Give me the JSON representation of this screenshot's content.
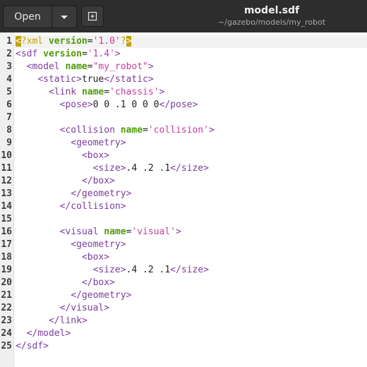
{
  "header": {
    "open_label": "Open",
    "menu_icon": "chevron-down-icon",
    "new_tab_icon": "new-tab-icon",
    "title": "model.sdf",
    "subtitle": "~/gazebo/models/my_robot"
  },
  "colors": {
    "tag": "#7a3e9d",
    "attribute": "#4e9a06",
    "string": "#c53f9c",
    "text": "#222222",
    "processing_instruction": "#c4a000"
  },
  "editor": {
    "cursor_line": 1,
    "lines": [
      {
        "n": "1",
        "tokens": [
          {
            "t": "pi-hl",
            "v": "<"
          },
          {
            "t": "pi",
            "v": "?xml "
          },
          {
            "t": "attr",
            "v": "version"
          },
          {
            "t": "txt",
            "v": "="
          },
          {
            "t": "str",
            "v": "'1.0'"
          },
          {
            "t": "pi",
            "v": "?"
          },
          {
            "t": "pi-hl",
            "v": ">"
          }
        ]
      },
      {
        "n": "2",
        "tokens": [
          {
            "t": "tag",
            "v": "<sdf "
          },
          {
            "t": "attr",
            "v": "version"
          },
          {
            "t": "txt",
            "v": "="
          },
          {
            "t": "str",
            "v": "'1.4'"
          },
          {
            "t": "tag",
            "v": ">"
          }
        ]
      },
      {
        "n": "3",
        "tokens": [
          {
            "t": "txt",
            "v": "  "
          },
          {
            "t": "tag",
            "v": "<model "
          },
          {
            "t": "attr",
            "v": "name"
          },
          {
            "t": "txt",
            "v": "="
          },
          {
            "t": "str",
            "v": "\"my_robot\""
          },
          {
            "t": "tag",
            "v": ">"
          }
        ]
      },
      {
        "n": "4",
        "tokens": [
          {
            "t": "txt",
            "v": "    "
          },
          {
            "t": "tag",
            "v": "<static>"
          },
          {
            "t": "txt",
            "v": "true"
          },
          {
            "t": "tag",
            "v": "</static>"
          }
        ]
      },
      {
        "n": "5",
        "tokens": [
          {
            "t": "txt",
            "v": "      "
          },
          {
            "t": "tag",
            "v": "<link "
          },
          {
            "t": "attr",
            "v": "name"
          },
          {
            "t": "txt",
            "v": "="
          },
          {
            "t": "str",
            "v": "'chassis'"
          },
          {
            "t": "tag",
            "v": ">"
          }
        ]
      },
      {
        "n": "6",
        "tokens": [
          {
            "t": "txt",
            "v": "        "
          },
          {
            "t": "tag",
            "v": "<pose>"
          },
          {
            "t": "txt",
            "v": "0 0 .1 0 0 0"
          },
          {
            "t": "tag",
            "v": "</pose>"
          }
        ]
      },
      {
        "n": "7",
        "tokens": []
      },
      {
        "n": "8",
        "tokens": [
          {
            "t": "txt",
            "v": "        "
          },
          {
            "t": "tag",
            "v": "<collision "
          },
          {
            "t": "attr",
            "v": "name"
          },
          {
            "t": "txt",
            "v": "="
          },
          {
            "t": "str",
            "v": "'collision'"
          },
          {
            "t": "tag",
            "v": ">"
          }
        ]
      },
      {
        "n": "9",
        "tokens": [
          {
            "t": "txt",
            "v": "          "
          },
          {
            "t": "tag",
            "v": "<geometry>"
          }
        ]
      },
      {
        "n": "10",
        "tokens": [
          {
            "t": "txt",
            "v": "            "
          },
          {
            "t": "tag",
            "v": "<box>"
          }
        ]
      },
      {
        "n": "11",
        "tokens": [
          {
            "t": "txt",
            "v": "              "
          },
          {
            "t": "tag",
            "v": "<size>"
          },
          {
            "t": "txt",
            "v": ".4 .2 .1"
          },
          {
            "t": "tag",
            "v": "</size>"
          }
        ]
      },
      {
        "n": "12",
        "tokens": [
          {
            "t": "txt",
            "v": "            "
          },
          {
            "t": "tag",
            "v": "</box>"
          }
        ]
      },
      {
        "n": "13",
        "tokens": [
          {
            "t": "txt",
            "v": "          "
          },
          {
            "t": "tag",
            "v": "</geometry>"
          }
        ]
      },
      {
        "n": "14",
        "tokens": [
          {
            "t": "txt",
            "v": "        "
          },
          {
            "t": "tag",
            "v": "</collision>"
          }
        ]
      },
      {
        "n": "15",
        "tokens": []
      },
      {
        "n": "16",
        "tokens": [
          {
            "t": "txt",
            "v": "        "
          },
          {
            "t": "tag",
            "v": "<visual "
          },
          {
            "t": "attr",
            "v": "name"
          },
          {
            "t": "txt",
            "v": "="
          },
          {
            "t": "str",
            "v": "'visual'"
          },
          {
            "t": "tag",
            "v": ">"
          }
        ]
      },
      {
        "n": "17",
        "tokens": [
          {
            "t": "txt",
            "v": "          "
          },
          {
            "t": "tag",
            "v": "<geometry>"
          }
        ]
      },
      {
        "n": "18",
        "tokens": [
          {
            "t": "txt",
            "v": "            "
          },
          {
            "t": "tag",
            "v": "<box>"
          }
        ]
      },
      {
        "n": "19",
        "tokens": [
          {
            "t": "txt",
            "v": "              "
          },
          {
            "t": "tag",
            "v": "<size>"
          },
          {
            "t": "txt",
            "v": ".4 .2 .1"
          },
          {
            "t": "tag",
            "v": "</size>"
          }
        ]
      },
      {
        "n": "20",
        "tokens": [
          {
            "t": "txt",
            "v": "            "
          },
          {
            "t": "tag",
            "v": "</box>"
          }
        ]
      },
      {
        "n": "21",
        "tokens": [
          {
            "t": "txt",
            "v": "          "
          },
          {
            "t": "tag",
            "v": "</geometry>"
          }
        ]
      },
      {
        "n": "22",
        "tokens": [
          {
            "t": "txt",
            "v": "        "
          },
          {
            "t": "tag",
            "v": "</visual>"
          }
        ]
      },
      {
        "n": "23",
        "tokens": [
          {
            "t": "txt",
            "v": "      "
          },
          {
            "t": "tag",
            "v": "</link>"
          }
        ]
      },
      {
        "n": "24",
        "tokens": [
          {
            "t": "txt",
            "v": "  "
          },
          {
            "t": "tag",
            "v": "</model>"
          }
        ]
      },
      {
        "n": "25",
        "tokens": [
          {
            "t": "tag",
            "v": "</sdf>"
          }
        ]
      }
    ]
  }
}
